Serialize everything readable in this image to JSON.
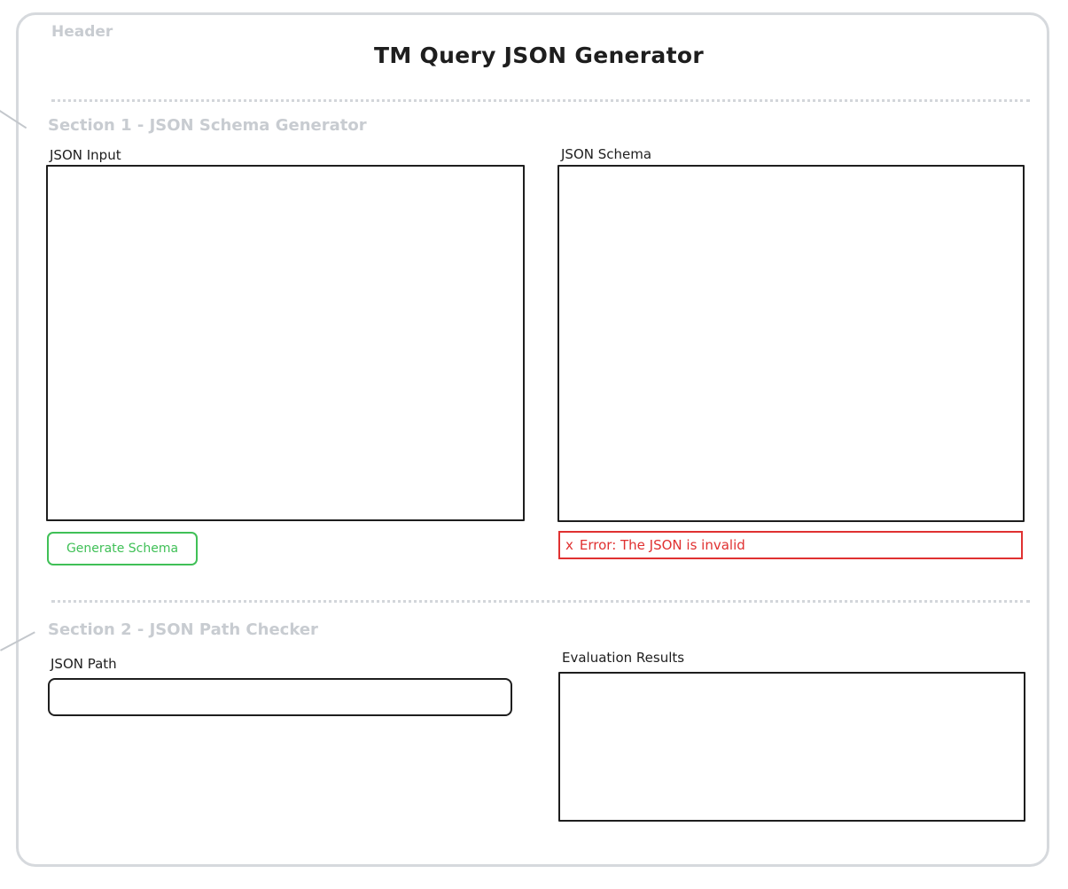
{
  "header": {
    "tag": "Header",
    "title": "TM Query JSON Generator"
  },
  "section1": {
    "title": "Section 1 - JSON Schema Generator",
    "json_input": {
      "label": "JSON Input",
      "value": ""
    },
    "json_schema": {
      "label": "JSON Schema",
      "value": ""
    },
    "generate_button": {
      "label": "Generate Schema",
      "color": "#40c057"
    },
    "error": {
      "icon": "x",
      "message": "Error: The JSON is invalid",
      "color": "#e03131"
    }
  },
  "section2": {
    "title": "Section 2 - JSON Path Checker",
    "json_path": {
      "label": "JSON Path",
      "value": ""
    },
    "evaluation_results": {
      "label": "Evaluation Results",
      "value": ""
    }
  }
}
